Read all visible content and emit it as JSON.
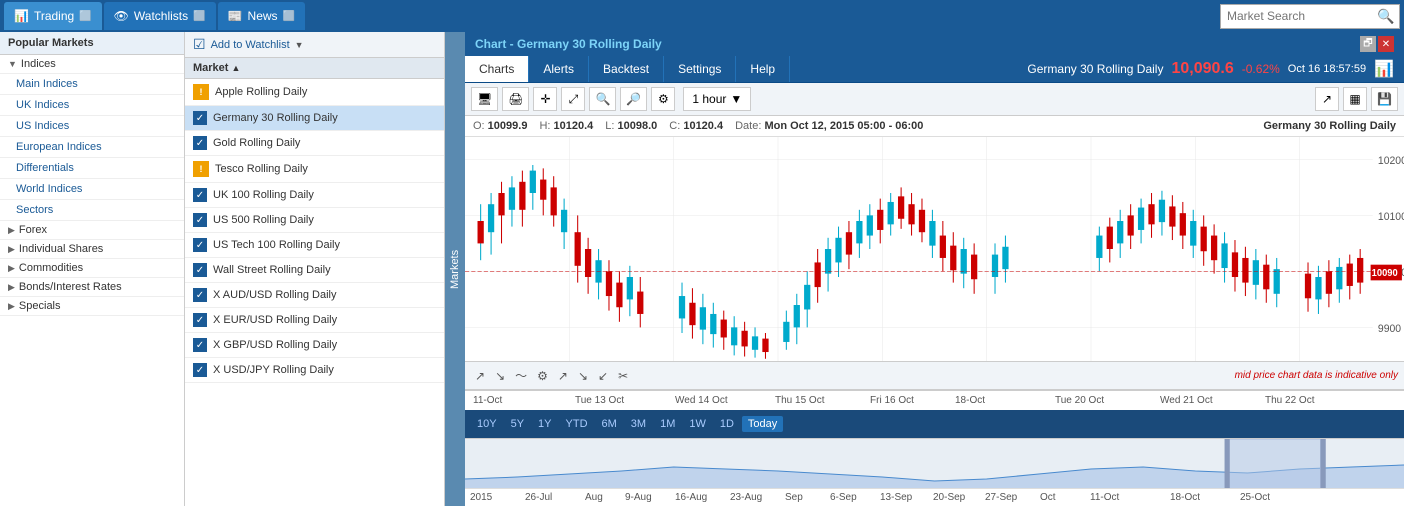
{
  "topbar": {
    "tabs": [
      {
        "label": "Trading",
        "icon": "📊",
        "active": true
      },
      {
        "label": "Watchlists",
        "icon": "👁",
        "active": false
      },
      {
        "label": "News",
        "icon": "📰",
        "active": false
      }
    ],
    "search_placeholder": "Market Search"
  },
  "sidebar": {
    "popular_markets": "Popular Markets",
    "groups": [
      {
        "label": "Indices",
        "arrow": "▼",
        "expanded": true
      },
      {
        "label": "Main Indices",
        "indent": true
      },
      {
        "label": "UK Indices",
        "indent": true
      },
      {
        "label": "US Indices",
        "indent": true
      },
      {
        "label": "European Indices",
        "indent": true
      },
      {
        "label": "Differentials",
        "indent": true
      },
      {
        "label": "World Indices",
        "indent": true
      },
      {
        "label": "Sectors",
        "indent": true
      },
      {
        "label": "Forex",
        "arrow": "▶",
        "expanded": false
      },
      {
        "label": "Individual Shares",
        "arrow": "▶",
        "expanded": false
      },
      {
        "label": "Commodities",
        "arrow": "▶",
        "expanded": false
      },
      {
        "label": "Bonds/Interest Rates",
        "arrow": "▶",
        "expanded": false
      },
      {
        "label": "Specials",
        "arrow": "▶",
        "expanded": false
      }
    ],
    "markets_label": "Markets"
  },
  "markets_panel": {
    "add_watchlist": "Add to Watchlist",
    "column_header": "Market",
    "items": [
      {
        "name": "Apple Rolling Daily",
        "type": "warning",
        "checked": false
      },
      {
        "name": "Germany 30 Rolling Daily",
        "type": "checked",
        "checked": true
      },
      {
        "name": "Gold Rolling Daily",
        "type": "checked",
        "checked": true
      },
      {
        "name": "Tesco Rolling Daily",
        "type": "warning",
        "checked": false
      },
      {
        "name": "UK 100 Rolling Daily",
        "type": "checked",
        "checked": true
      },
      {
        "name": "US 500 Rolling Daily",
        "type": "checked",
        "checked": true
      },
      {
        "name": "US Tech 100 Rolling Daily",
        "type": "checked",
        "checked": true
      },
      {
        "name": "Wall Street Rolling Daily",
        "type": "checked",
        "checked": true
      },
      {
        "name": "X AUD/USD Rolling Daily",
        "type": "checked",
        "checked": true
      },
      {
        "name": "X EUR/USD Rolling Daily",
        "type": "checked",
        "checked": true
      },
      {
        "name": "X GBP/USD Rolling Daily",
        "type": "checked",
        "checked": true
      },
      {
        "name": "X USD/JPY Rolling Daily",
        "type": "checked",
        "checked": true
      }
    ]
  },
  "chart": {
    "title": "Chart - Germany 30 Rolling Daily",
    "instrument": "Germany 30 Rolling Daily",
    "price": "10,090.6",
    "change": "-0.62%",
    "datetime": "Oct 16 18:57:59",
    "tabs": [
      "Charts",
      "Alerts",
      "Backtest",
      "Settings",
      "Help"
    ],
    "active_tab": "Charts",
    "timeframe": "1 hour",
    "ohlc": {
      "open_label": "O:",
      "open": "10099.9",
      "high_label": "H:",
      "high": "10120.4",
      "low_label": "L:",
      "low": "10098.0",
      "close_label": "C:",
      "close": "10120.4",
      "date_label": "Date:",
      "date": "Mon Oct 12, 2015 05:00 - 06:00"
    },
    "y_axis": {
      "max": "10200",
      "mid": "10100",
      "current": "10090.6",
      "lower": "10000",
      "min": "9900"
    },
    "x_axis_labels": [
      "11-Oct",
      "Tue 13 Oct",
      "Wed 14 Oct",
      "Thu 15 Oct",
      "Fri 16 Oct",
      "18-Oct",
      "Tue 20 Oct",
      "Wed 21 Oct",
      "Thu 22 Oct"
    ],
    "indicative_text": "mid price chart data is indicative only",
    "draw_tools": [
      "↗",
      "↘",
      "~",
      "🔧",
      "↗",
      "↘",
      "↙",
      "✂"
    ],
    "timeline_buttons": [
      "10Y",
      "5Y",
      "1Y",
      "YTD",
      "6M",
      "3M",
      "1M",
      "1W",
      "1D",
      "Today"
    ],
    "active_timeline": "Today",
    "overview_labels": [
      "2015",
      "26-Jul",
      "Aug",
      "9-Aug",
      "16-Aug",
      "23-Aug",
      "Sep",
      "6-Sep",
      "13-Sep",
      "20-Sep",
      "27-Sep",
      "Oct",
      "11-Oct",
      "18-Oct",
      "25-Oct"
    ]
  }
}
